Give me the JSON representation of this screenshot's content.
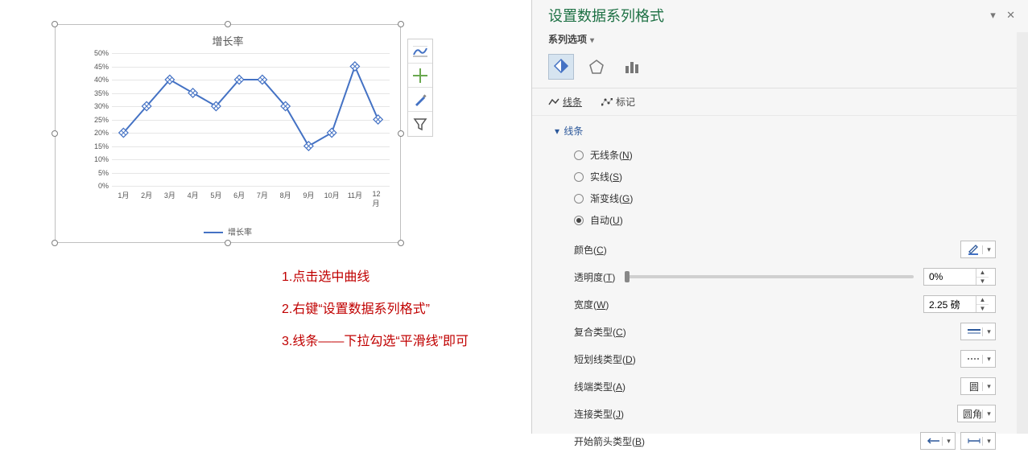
{
  "chart_data": {
    "type": "line",
    "title": "增长率",
    "categories": [
      "1月",
      "2月",
      "3月",
      "4月",
      "5月",
      "6月",
      "7月",
      "8月",
      "9月",
      "10月",
      "11月",
      "12月"
    ],
    "values": [
      20,
      30,
      40,
      35,
      30,
      40,
      40,
      30,
      15,
      20,
      45,
      25
    ],
    "series_name": "增长率",
    "ylim": [
      0,
      50
    ],
    "ytick_step": 5,
    "y_suffix": "%",
    "line_color": "#4472c4"
  },
  "annotations": {
    "a1": "1.点击选中曲线",
    "a2": "2.右键“设置数据系列格式”",
    "a3": "3.线条——下拉勾选“平滑线”即可"
  },
  "pane": {
    "title": "设置数据系列格式",
    "series_options_label": "系列选项",
    "tabs": {
      "line": "线条",
      "marker": "标记"
    },
    "section_line": "线条",
    "radios": {
      "none": {
        "text": "无线条",
        "accel": "N"
      },
      "solid": {
        "text": "实线",
        "accel": "S"
      },
      "gradient": {
        "text": "渐变线",
        "accel": "G"
      },
      "auto": {
        "text": "自动",
        "accel": "U",
        "selected": true
      }
    },
    "props": {
      "color": {
        "label": "颜色",
        "accel": "C"
      },
      "transparency": {
        "label": "透明度",
        "accel": "T",
        "value": "0%"
      },
      "width": {
        "label": "宽度",
        "accel": "W",
        "value": "2.25 磅"
      },
      "compound": {
        "label": "复合类型",
        "accel": "C"
      },
      "dash": {
        "label": "短划线类型",
        "accel": "D"
      },
      "cap": {
        "label": "线端类型",
        "accel": "A",
        "value": "圆"
      },
      "join": {
        "label": "连接类型",
        "accel": "J",
        "value": "圆角"
      },
      "begin_arrow": {
        "label": "开始箭头类型",
        "accel": "B"
      }
    }
  }
}
